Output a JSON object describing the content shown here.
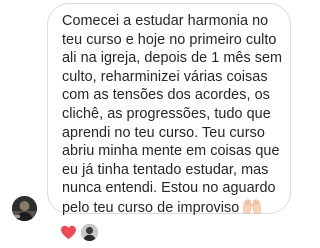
{
  "message": {
    "lines": [
      "Comecei a estudar harmonia no",
      "teu curso e hoje no primeiro culto",
      "ali na igreja, depois de 1 mês sem",
      "culto, reharminizei várias coisas",
      "com as tensões dos acordes, os",
      "clichê, as progressões, tudo que",
      "aprendi no teu curso. Teu curso",
      "abriu minha mente em coisas que",
      "eu já tinha tentado estudar, mas",
      "nunca entendi. Estou no aguardo",
      "pelo teu curso de improviso"
    ],
    "trailing_emoji": "raising-hands-emoji"
  },
  "sender": {
    "avatar_icon": "user-avatar"
  },
  "reactions": {
    "items": [
      {
        "icon": "heart-icon",
        "color": "#ed4956"
      },
      {
        "icon": "reactor-avatar"
      }
    ]
  },
  "colors": {
    "text": "#262626",
    "bubble_border": "#dcdcdc",
    "heart": "#ed4956",
    "emoji": "#fad3b6"
  }
}
